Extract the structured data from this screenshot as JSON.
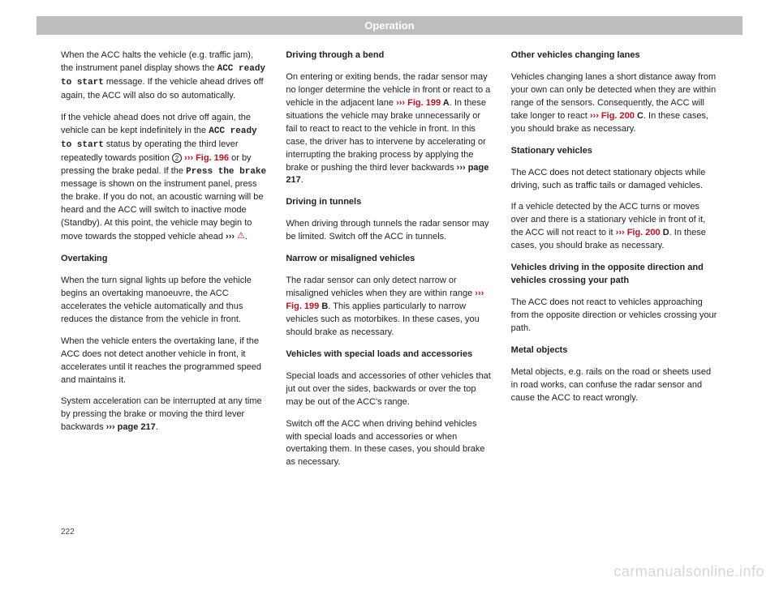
{
  "header": "Operation",
  "page_number": "222",
  "watermark": "carmanualsonline.info",
  "col1": {
    "p1a": "When the ACC halts the vehicle (e.g. traffic jam), the instrument panel display shows the ",
    "p1b": "ACC ready to start",
    "p1c": " message. If the vehicle ahead drives off again, the ACC will also do so automatically.",
    "p2a": "If the vehicle ahead does not drive off again, the vehicle can be kept indefinitely in the ",
    "p2b": "ACC ready to start",
    "p2c": " status by operating the third lever repeatedly towards position ",
    "p2circ": "2",
    "p2ref1": " ››› Fig. 196",
    "p2d": " or by pressing the brake pedal. If the ",
    "p2e": "Press the brake",
    "p2f": " message is shown on the instrument panel, press the brake. If you do not, an acoustic warning will be heard and the ACC will switch to inactive mode (Standby). At this point, the vehicle may begin to move towards the stopped vehicle ahead ",
    "p2g": "›››",
    "p2h": ".",
    "h1": "Overtaking",
    "p3": "When the turn signal lights up before the vehicle begins an overtaking manoeuvre, the ACC accelerates the vehicle automatically and thus reduces the distance from the vehicle in front.",
    "p4": "When the vehicle enters the overtaking lane, if the ACC does not detect another vehicle in front, it accelerates until it reaches the programmed speed and maintains it.",
    "p5a": "System acceleration can be interrupted at any time by pressing the brake or moving the third lever backwards ",
    "p5b": "››› page 217",
    "p5c": "."
  },
  "col2": {
    "h1": "Driving through a bend",
    "p1a": "On entering or exiting bends, the radar sensor may no longer determine the vehicle in front or react to a vehicle in the adjacent lane ",
    "p1ref": "››› Fig. 199",
    "p1b": " A",
    "p1c": ". In these situations the vehicle may brake unnecessarily or fail to react to react to the vehicle in front. In this case, the driver has to intervene by accelerating or interrupting the braking process by applying the brake or pushing the third lever backwards ",
    "p1d": "››› page 217",
    "p1e": ".",
    "h2": "Driving in tunnels",
    "p2": "When driving through tunnels the radar sensor may be limited. Switch off the ACC in tunnels.",
    "h3": "Narrow or misaligned vehicles",
    "p3a": "The radar sensor can only detect narrow or misaligned vehicles when they are within range ",
    "p3ref": "››› Fig. 199",
    "p3b": " B",
    "p3c": ". This applies particularly to narrow vehicles such as motorbikes. In these cases, you should brake as necessary.",
    "h4": "Vehicles with special loads and accessories",
    "p4": "Special loads and accessories of other vehicles that jut out over the sides, backwards or over the top may be out of the ACC's range.",
    "p5": "Switch off the ACC when driving behind vehicles with special loads and accessories or when overtaking them. In these cases, you should brake as necessary."
  },
  "col3": {
    "h1": "Other vehicles changing lanes",
    "p1a": "Vehicles changing lanes a short distance away from your own can only be detected when they are within range of the sensors. Consequently, the ACC will take longer to react ",
    "p1ref": "››› Fig. 200",
    "p1b": " C",
    "p1c": ". In these cases, you should brake as necessary.",
    "h2": "Stationary vehicles",
    "p2": "The ACC does not detect stationary objects while driving, such as traffic tails or damaged vehicles.",
    "p3a": "If a vehicle detected by the ACC turns or moves over and there is a stationary vehicle in front of it, the ACC will not react to it ",
    "p3ref": "››› Fig. 200",
    "p3b": " D",
    "p3c": ". In these cases, you should brake as necessary.",
    "h3": "Vehicles driving in the opposite direction and vehicles crossing your path",
    "p4": "The ACC does not react to vehicles approaching from the opposite direction or vehicles crossing your path.",
    "h4": "Metal objects",
    "p5": "Metal objects, e.g. rails on the road or sheets used in road works, can confuse the radar sensor and cause the ACC to react wrongly."
  }
}
